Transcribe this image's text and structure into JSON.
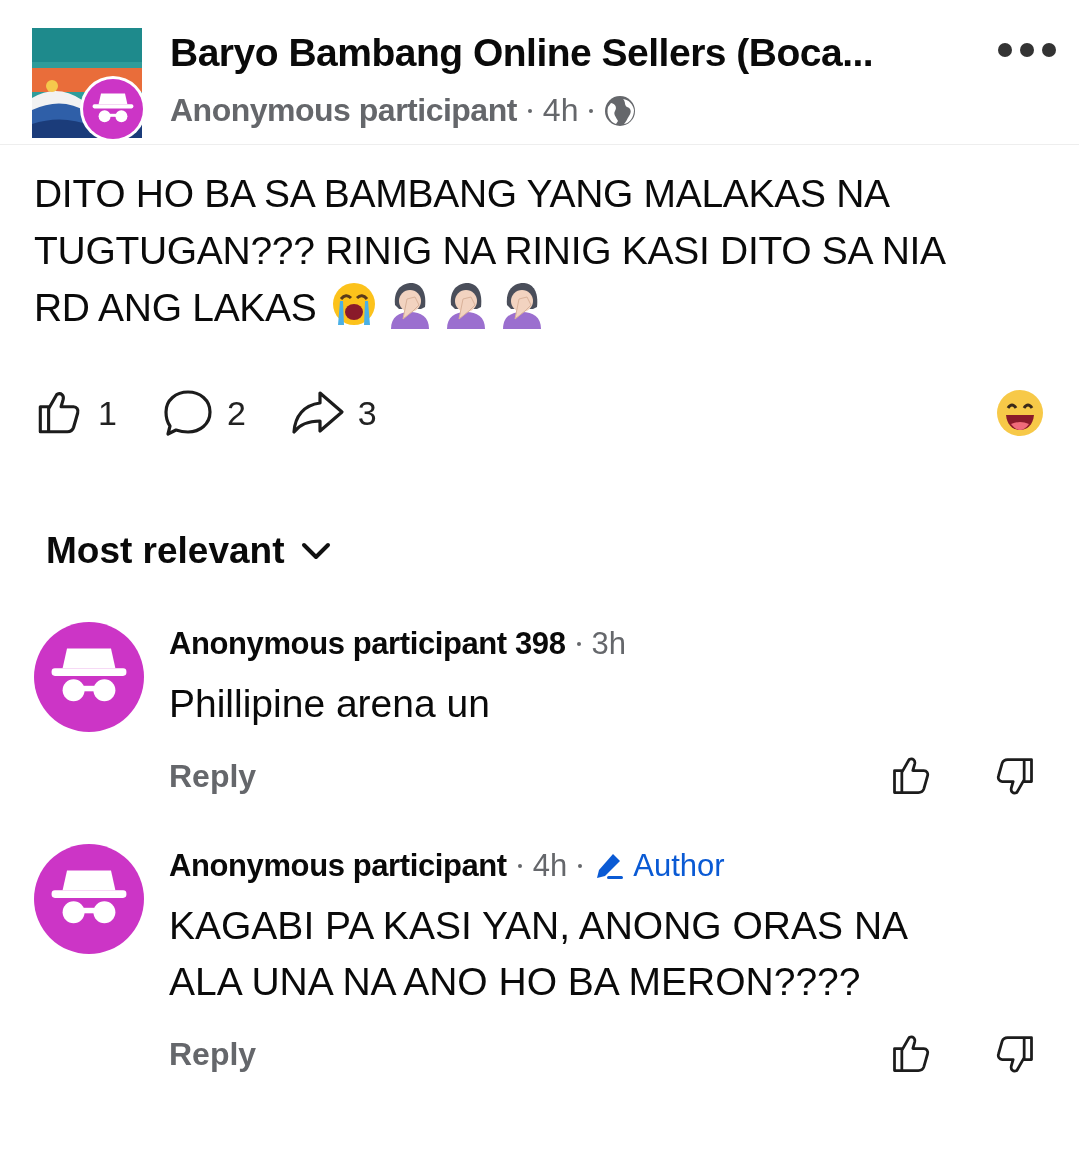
{
  "post": {
    "group": "Baryo Bambang Online Sellers (Boca...",
    "author": "Anonymous participant",
    "time": "4h",
    "text_lines": [
      "DITO HO BA SA BAMBANG YANG MALAKAS NA",
      "TUGTUGAN??? RINIG NA RINIG KASI DITO SA NIA",
      "RD ANG LAKAS"
    ],
    "actions": [
      {
        "kind": "like",
        "count": "1"
      },
      {
        "kind": "comment",
        "count": "2"
      },
      {
        "kind": "share",
        "count": "3"
      }
    ]
  },
  "sort": {
    "label": "Most relevant"
  },
  "comments": [
    {
      "author": "Anonymous participant 398",
      "time": "3h",
      "text_lines": [
        "Phillipine arena un"
      ],
      "reply": "Reply"
    },
    {
      "author": "Anonymous participant",
      "time": "4h",
      "badge_label": "Author",
      "text_lines": [
        "KAGABI PA KASI YAN, ANONG ORAS NA",
        "ALA UNA NA ANO HO BA MERON????"
      ],
      "reply": "Reply"
    }
  ]
}
